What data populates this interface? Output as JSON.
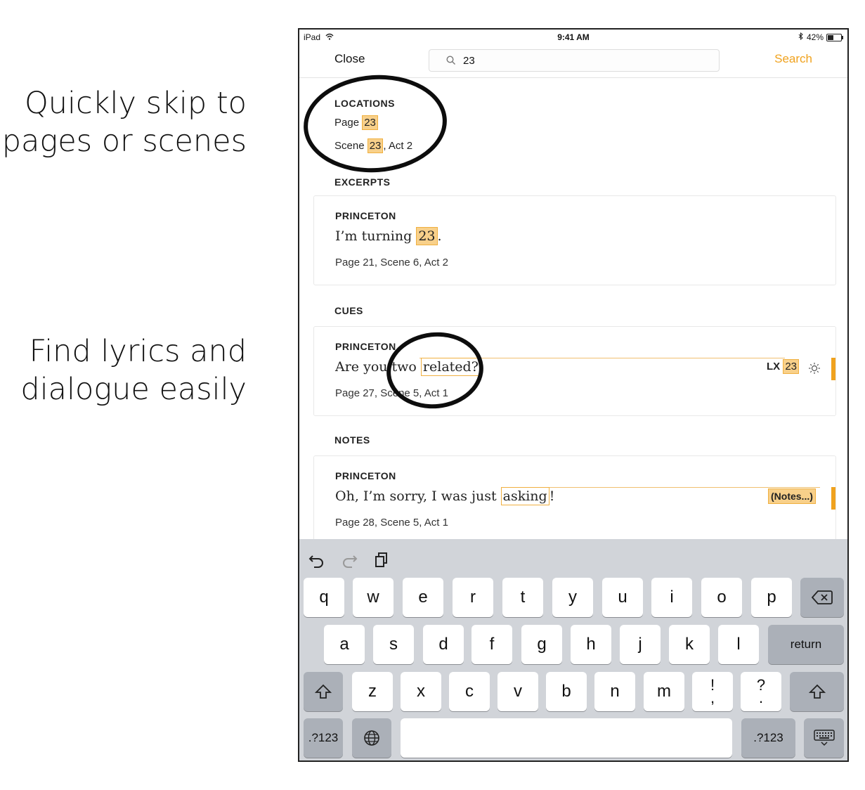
{
  "captions": {
    "top": [
      "Quickly skip to",
      "pages or scenes"
    ],
    "bottom": [
      "Find lyrics and",
      "dialogue easily"
    ]
  },
  "status_bar": {
    "device": "iPad",
    "time": "9:41 AM",
    "battery": "42%",
    "battery_level": 0.42
  },
  "nav": {
    "close_label": "Close",
    "search_value": "23",
    "search_label": "Search"
  },
  "locations": {
    "heading": "LOCATIONS",
    "page": {
      "prefix": "Page ",
      "match": "23"
    },
    "scene": {
      "prefix": "Scene ",
      "match": "23",
      "suffix": ", Act 2"
    }
  },
  "excerpts": {
    "heading": "EXCERPTS",
    "character": "PRINCETON",
    "line_before": "I’m turning ",
    "line_match": "23",
    "line_after": ".",
    "meta": "Page 21, Scene 6, Act 2"
  },
  "cues": {
    "heading": "CUES",
    "character": "PRINCETON",
    "line_before": "Are you two ",
    "line_match": "related?",
    "meta": "Page 27, Scene 5, Act 1",
    "tag_prefix": "LX",
    "tag_match": "23"
  },
  "notes": {
    "heading": "NOTES",
    "character": "PRINCETON",
    "line_before": "Oh, I’m sorry, I was just ",
    "line_match": "asking",
    "line_after": "!",
    "meta": "Page 28, Scene 5, Act 1",
    "tag": "(Notes...)"
  },
  "keyboard": {
    "row1": [
      "q",
      "w",
      "e",
      "r",
      "t",
      "y",
      "u",
      "i",
      "o",
      "p"
    ],
    "row2": [
      "a",
      "s",
      "d",
      "f",
      "g",
      "h",
      "j",
      "k",
      "l"
    ],
    "row3": [
      "z",
      "x",
      "c",
      "v",
      "b",
      "n",
      "m"
    ],
    "punct1": {
      "top": "!",
      "bottom": ","
    },
    "punct2": {
      "top": "?",
      "bottom": "."
    },
    "return_label": "return",
    "numbers_label": ".?123"
  },
  "colors": {
    "accent": "#f0a21e",
    "highlight": "#f8d08a",
    "keyboard_bg": "#d1d4d9"
  }
}
